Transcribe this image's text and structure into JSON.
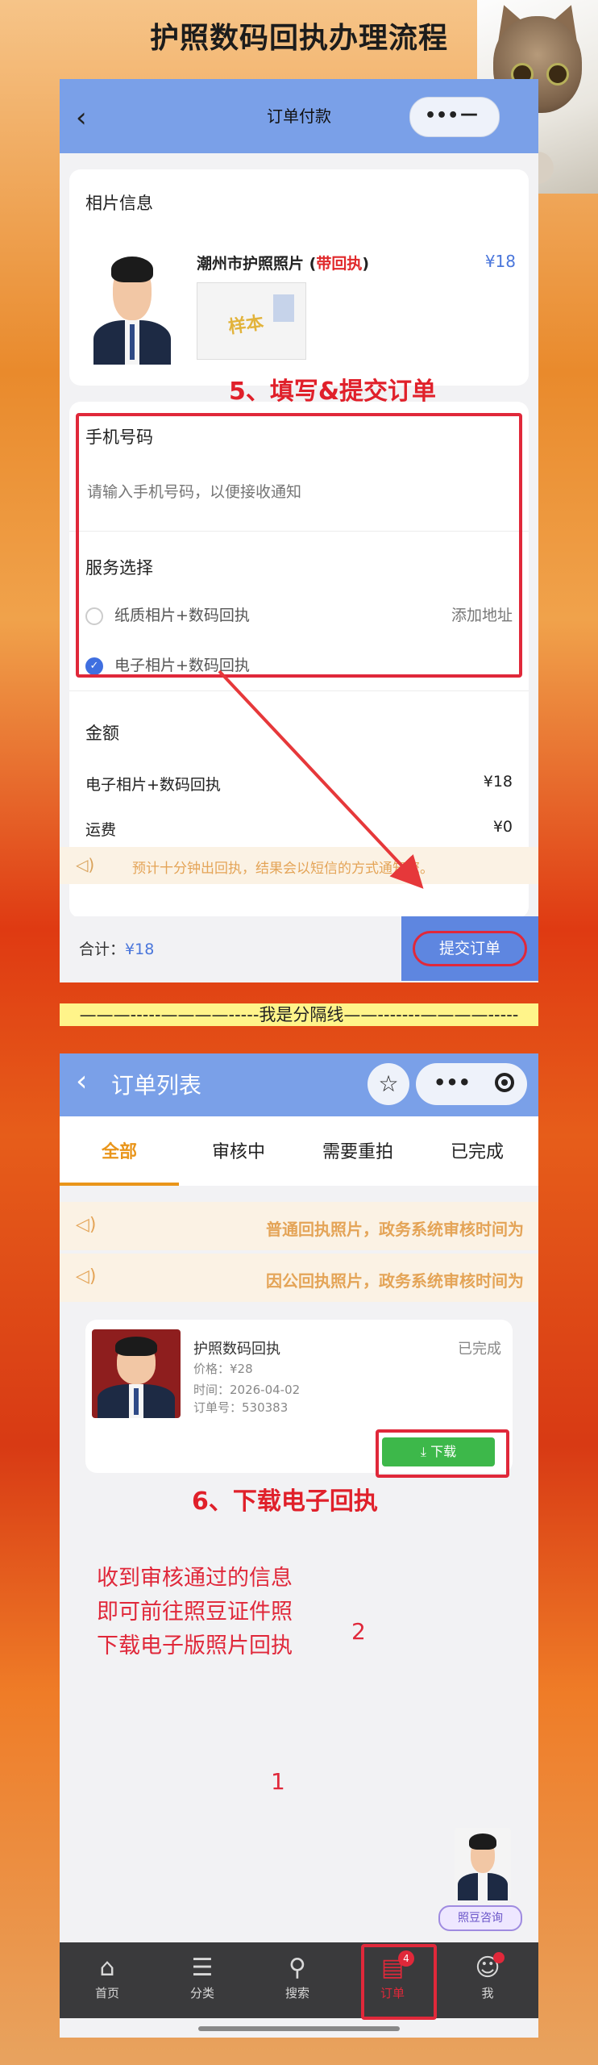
{
  "page_title": "护照数码回执办理流程",
  "screen1": {
    "nav_title": "订单付款",
    "photo_section_title": "相片信息",
    "product_name_prefix": "潮州市护照照片 (",
    "product_name_tag": "带回执",
    "product_name_suffix": ")",
    "product_price": "¥18",
    "sample_stamp": "样本",
    "phone_label": "手机号码",
    "phone_placeholder": "请输入手机号码，以便接收通知",
    "service_label": "服务选择",
    "option1": "纸质相片+数码回执",
    "option1_action": "添加地址",
    "option2": "电子相片+数码回执",
    "amount_label": "金额",
    "amount_item": "电子相片+数码回执",
    "amount_item_value": "¥18",
    "shipping_label": "运费",
    "shipping_value": "¥0",
    "notice": "预计十分钟出回执，结果会以短信的方式通知您。",
    "total_label": "合计：",
    "total_value": "¥18",
    "submit_label": "提交订单"
  },
  "annotations": {
    "step5": "5、填写&提交订单",
    "separator": "———-----————-----我是分隔线——-------————-----",
    "step6": "6、下载电子回执",
    "hint_line1": "收到审核通过的信息",
    "hint_line2": "即可前往照豆证件照",
    "hint_line3": "下载电子版照片回执",
    "num1": "1",
    "num2": "2"
  },
  "screen2": {
    "nav_title": "订单列表",
    "tabs": [
      "全部",
      "审核中",
      "需要重拍",
      "已完成"
    ],
    "notice1": "普通回执照片，政务系统审核时间为",
    "notice2": "因公回执照片，政务系统审核时间为",
    "order": {
      "title": "护照数码回执",
      "status": "已完成",
      "price": "价格：¥28",
      "time": "时间：2026-04-02",
      "order_no": "订单号：530383",
      "download": "下载"
    },
    "consult_label": "照豆咨询",
    "tabbar": [
      {
        "label": "首页",
        "icon": "home-icon"
      },
      {
        "label": "分类",
        "icon": "category-icon"
      },
      {
        "label": "搜索",
        "icon": "search-icon"
      },
      {
        "label": "订单",
        "icon": "order-icon",
        "badge": "4"
      },
      {
        "label": "我",
        "icon": "user-icon"
      }
    ]
  },
  "colors": {
    "accent_blue": "#7aa0e8",
    "red": "#e0283a",
    "orange": "#e9951a",
    "green": "#3db84a"
  }
}
